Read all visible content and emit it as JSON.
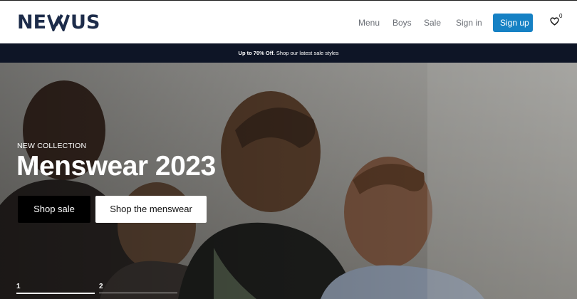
{
  "brand": {
    "logo_prefix": "NE",
    "logo_suffix": "US",
    "color": "#1d2c4a"
  },
  "nav": {
    "items": [
      "Menu",
      "Boys",
      "Sale",
      "Sign in"
    ],
    "signup_label": "Sign up",
    "wishlist_count": "0",
    "accent": "#1681c4"
  },
  "promo": {
    "highlight": "Up to 70% Off.",
    "text": "Shop our latest sale styles"
  },
  "hero": {
    "eyebrow": "NEW COLLECTION",
    "title": "Menswear 2023",
    "primary_cta": "Shop sale",
    "secondary_cta": "Shop the menswear",
    "slides": [
      "1",
      "2"
    ],
    "active_slide": 1
  }
}
